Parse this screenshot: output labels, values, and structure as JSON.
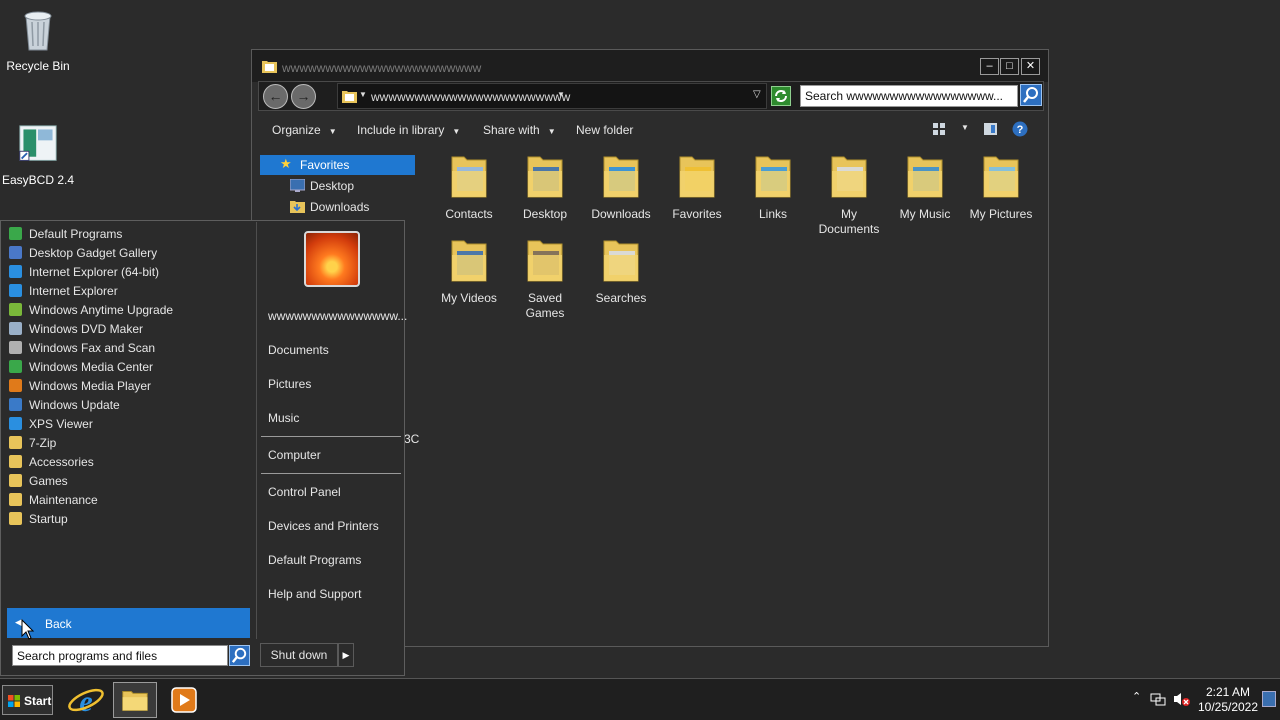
{
  "desktop": {
    "icons": [
      {
        "label": "Recycle Bin"
      },
      {
        "label": "EasyBCD 2.4"
      }
    ]
  },
  "explorer": {
    "title": "wwwwwwwwwwwwwwwwwwwwwww",
    "address": "wwwwwwwwwwwwwwwwwwwwwww",
    "search_value": "Search wwwwwwwwwwwwwwwww...",
    "toolbar": {
      "organize": "Organize",
      "include_in_library": "Include in library",
      "share_with": "Share with",
      "new_folder": "New folder"
    },
    "nav_pane": [
      {
        "label": "Favorites"
      },
      {
        "label": "Desktop"
      },
      {
        "label": "Downloads"
      }
    ],
    "partial_text": "3C",
    "folders": [
      {
        "label": "Contacts"
      },
      {
        "label": "Desktop"
      },
      {
        "label": "Downloads"
      },
      {
        "label": "Favorites"
      },
      {
        "label": "Links"
      },
      {
        "label": "My Documents"
      },
      {
        "label": "My Music"
      },
      {
        "label": "My Pictures"
      },
      {
        "label": "My Videos"
      },
      {
        "label": "Saved Games"
      },
      {
        "label": "Searches"
      }
    ]
  },
  "start_menu": {
    "programs": [
      {
        "label": "Default Programs",
        "color": "#3aa84a"
      },
      {
        "label": "Desktop Gadget Gallery",
        "color": "#4a78c8"
      },
      {
        "label": "Internet Explorer (64-bit)",
        "color": "#2a8fe0"
      },
      {
        "label": "Internet Explorer",
        "color": "#2a8fe0"
      },
      {
        "label": "Windows Anytime Upgrade",
        "color": "#7ab83a"
      },
      {
        "label": "Windows DVD Maker",
        "color": "#9ab0c8"
      },
      {
        "label": "Windows Fax and Scan",
        "color": "#b0b0b0"
      },
      {
        "label": "Windows Media Center",
        "color": "#3aa84a"
      },
      {
        "label": "Windows Media Player",
        "color": "#e07a1a"
      },
      {
        "label": "Windows Update",
        "color": "#3a7ac8"
      },
      {
        "label": "XPS Viewer",
        "color": "#2a8fe0"
      },
      {
        "label": "7-Zip",
        "color": "#e8c45a"
      },
      {
        "label": "Accessories",
        "color": "#e8c45a"
      },
      {
        "label": "Games",
        "color": "#e8c45a"
      },
      {
        "label": "Maintenance",
        "color": "#e8c45a"
      },
      {
        "label": "Startup",
        "color": "#e8c45a"
      }
    ],
    "back_label": "Back",
    "user_name": "wwwwwwwwwwwwwww...",
    "right_items": {
      "documents": "Documents",
      "pictures": "Pictures",
      "music": "Music",
      "computer": "Computer",
      "control_panel": "Control Panel",
      "devices_and_printers": "Devices and Printers",
      "default_programs": "Default Programs",
      "help_and_support": "Help and Support"
    },
    "search_placeholder": "Search programs and files",
    "shutdown_label": "Shut down"
  },
  "taskbar": {
    "start_label": "Start",
    "time": "2:21 AM",
    "date": "10/25/2022"
  }
}
